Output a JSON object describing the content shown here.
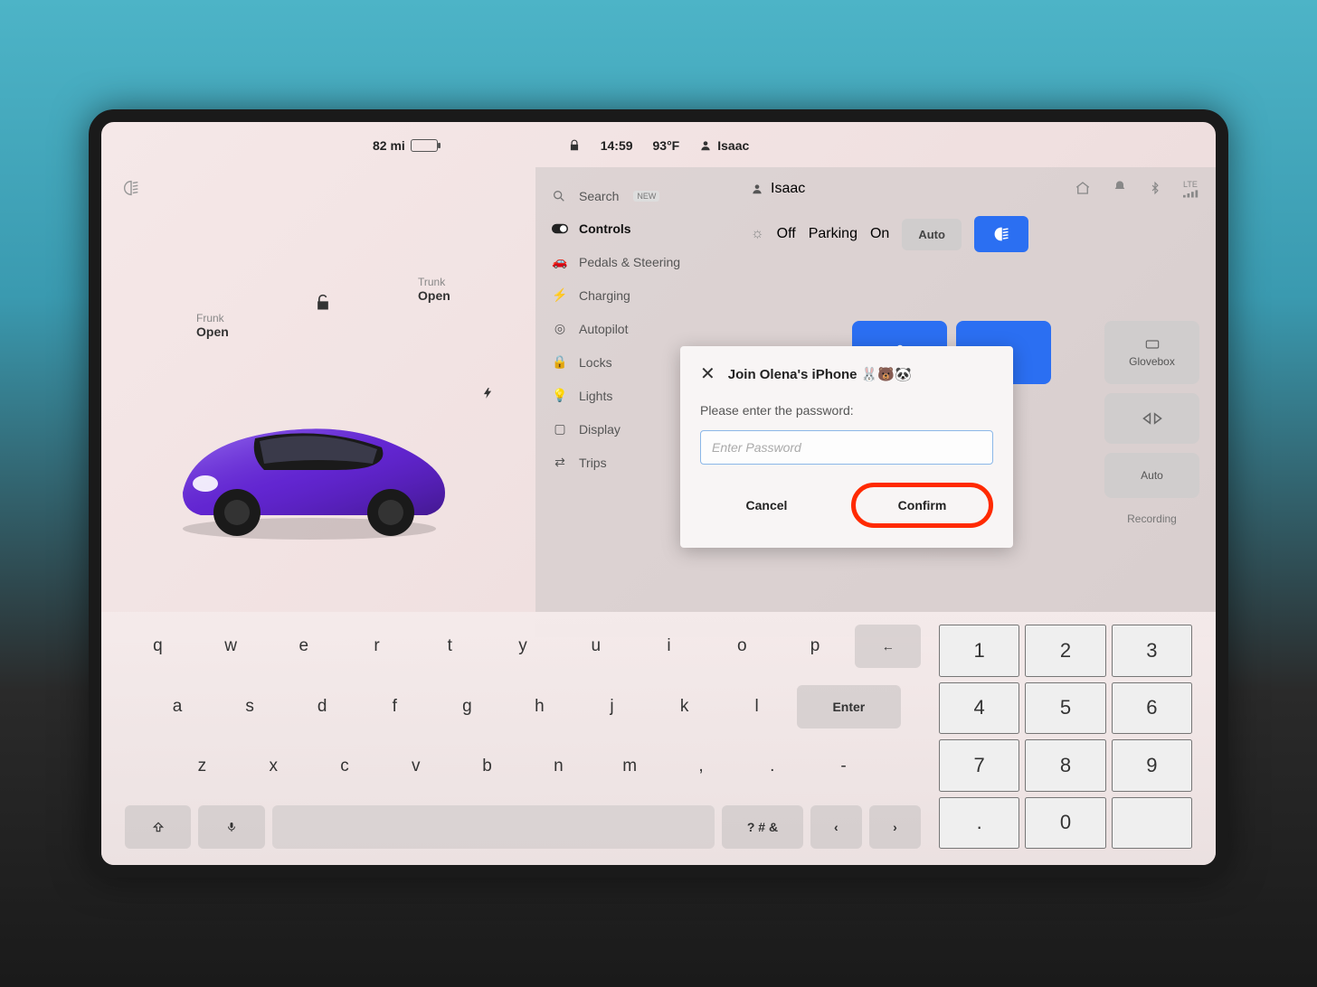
{
  "status_bar": {
    "range": "82 mi",
    "time": "14:59",
    "temperature": "93°F",
    "profile": "Isaac"
  },
  "left_panel": {
    "frunk": {
      "title": "Frunk",
      "value": "Open"
    },
    "trunk": {
      "title": "Trunk",
      "value": "Open"
    }
  },
  "menu": {
    "search": "Search",
    "search_badge": "NEW",
    "items": [
      "Controls",
      "Pedals & Steering",
      "Charging",
      "Autopilot",
      "Locks",
      "Lights",
      "Display",
      "Trips"
    ],
    "active_index": 0
  },
  "right_panel": {
    "profile": "Isaac",
    "lights": {
      "off": "Off",
      "parking": "Parking",
      "on": "On",
      "auto": "Auto"
    },
    "glovebox": "Glovebox",
    "climate_auto": "Auto",
    "recording": "Recording"
  },
  "dialog": {
    "title": "Join Olena's iPhone 🐰🐻🐼",
    "subtitle": "Please enter the password:",
    "placeholder": "Enter Password",
    "cancel": "Cancel",
    "confirm": "Confirm"
  },
  "keyboard": {
    "row1": [
      "q",
      "w",
      "e",
      "r",
      "t",
      "y",
      "u",
      "i",
      "o",
      "p",
      "←"
    ],
    "row2": [
      "a",
      "s",
      "d",
      "f",
      "g",
      "h",
      "j",
      "k",
      "l"
    ],
    "enter": "Enter",
    "row3": [
      "z",
      "x",
      "c",
      "v",
      "b",
      "n",
      "m",
      ",",
      ".",
      "-"
    ],
    "symbols": "? # &",
    "numpad": [
      "1",
      "2",
      "3",
      "4",
      "5",
      "6",
      "7",
      "8",
      "9",
      ".",
      "0"
    ]
  }
}
